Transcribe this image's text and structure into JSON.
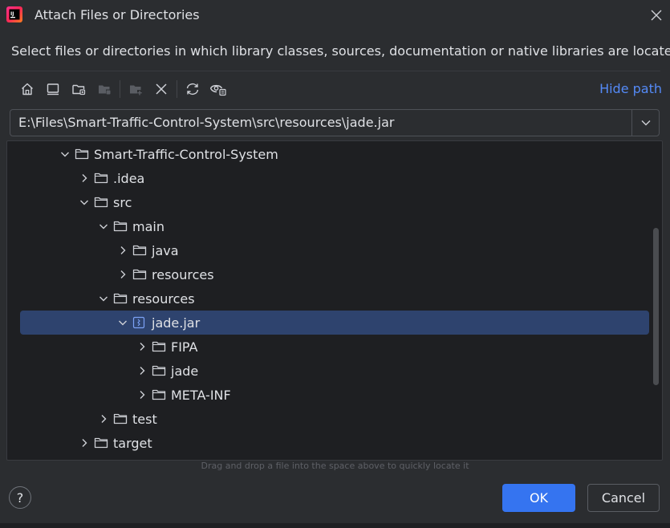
{
  "window": {
    "title": "Attach Files or Directories",
    "app_icon": "intellij-idea-icon"
  },
  "description": "Select files or directories in which library classes, sources, documentation or native libraries are located",
  "toolbar": {
    "buttons": [
      {
        "name": "home-icon",
        "enabled": true
      },
      {
        "name": "desktop-icon",
        "enabled": true
      },
      {
        "name": "project-folder-icon",
        "enabled": true
      },
      {
        "name": "module-folder-icon",
        "enabled": false
      },
      {
        "name": "new-folder-icon",
        "enabled": false
      },
      {
        "name": "delete-icon",
        "enabled": true
      },
      {
        "name": "refresh-icon",
        "enabled": true
      },
      {
        "name": "show-hidden-icon",
        "enabled": true
      }
    ],
    "hide_path_label": "Hide path"
  },
  "path": {
    "value": "E:\\Files\\Smart-Traffic-Control-System\\src\\resources\\jade.jar"
  },
  "tree": {
    "items": [
      {
        "label": "Smart-Traffic-Control-System",
        "depth": 0,
        "expanded": true,
        "type": "folder"
      },
      {
        "label": ".idea",
        "depth": 1,
        "expanded": false,
        "type": "folder"
      },
      {
        "label": "src",
        "depth": 1,
        "expanded": true,
        "type": "folder"
      },
      {
        "label": "main",
        "depth": 2,
        "expanded": true,
        "type": "folder"
      },
      {
        "label": "java",
        "depth": 3,
        "expanded": false,
        "type": "folder"
      },
      {
        "label": "resources",
        "depth": 3,
        "expanded": false,
        "type": "folder"
      },
      {
        "label": "resources",
        "depth": 2,
        "expanded": true,
        "type": "folder"
      },
      {
        "label": "jade.jar",
        "depth": 3,
        "expanded": true,
        "type": "jar",
        "selected": true
      },
      {
        "label": "FIPA",
        "depth": 4,
        "expanded": false,
        "type": "folder"
      },
      {
        "label": "jade",
        "depth": 4,
        "expanded": false,
        "type": "folder"
      },
      {
        "label": "META-INF",
        "depth": 4,
        "expanded": false,
        "type": "folder"
      },
      {
        "label": "test",
        "depth": 2,
        "expanded": false,
        "type": "folder"
      },
      {
        "label": "target",
        "depth": 1,
        "expanded": false,
        "type": "folder"
      }
    ]
  },
  "hint": "Drag and drop a file into the space above to quickly locate it",
  "footer": {
    "help_label": "?",
    "ok_label": "OK",
    "cancel_label": "Cancel"
  },
  "colors": {
    "background": "#2b2d30",
    "tree_background": "#1e1f22",
    "selection": "#2e436e",
    "accent": "#3574f0",
    "link": "#548af7"
  }
}
